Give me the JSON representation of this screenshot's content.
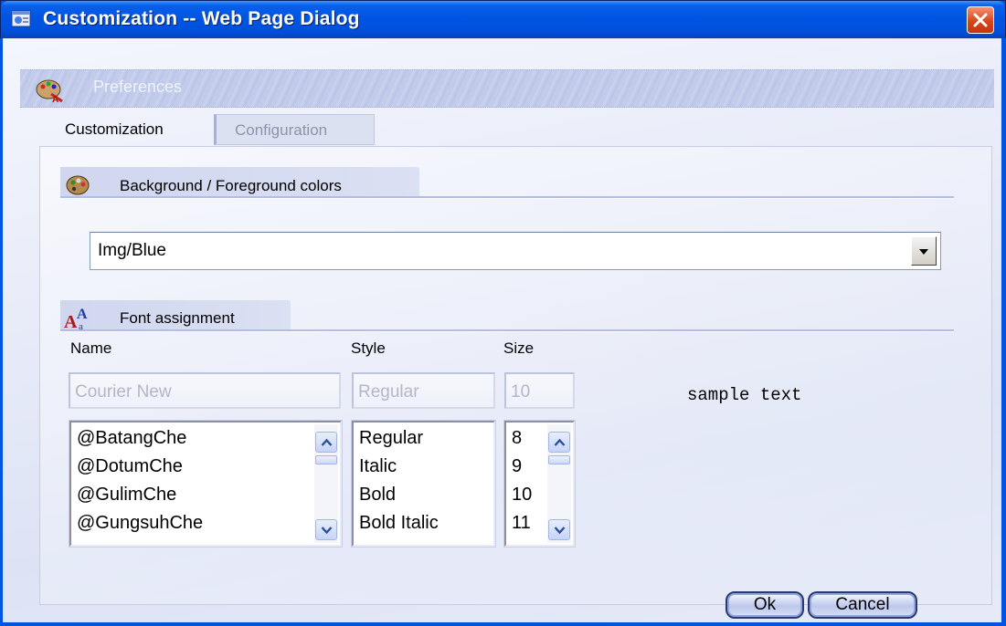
{
  "window": {
    "title": "Customization -- Web Page Dialog"
  },
  "header": {
    "label": "Preferences"
  },
  "tabs": [
    {
      "label": "Customization",
      "active": true
    },
    {
      "label": "Configuration",
      "active": false
    }
  ],
  "colors_section": {
    "title": "Background / Foreground colors",
    "selected": "Img/Blue"
  },
  "font_section": {
    "title": "Font assignment",
    "name_label": "Name",
    "style_label": "Style",
    "size_label": "Size",
    "name_value": "Courier New",
    "style_value": "Regular",
    "size_value": "10",
    "sample": "sample text",
    "name_list": [
      "@BatangChe",
      "@DotumChe",
      "@GulimChe",
      "@GungsuhChe"
    ],
    "style_list": [
      "Regular",
      "Italic",
      "Bold",
      "Bold Italic"
    ],
    "size_list": [
      "8",
      "9",
      "10",
      "11"
    ]
  },
  "buttons": {
    "ok": "Ok",
    "cancel": "Cancel"
  },
  "icons": {
    "title": "ie-dialog-icon",
    "header": "palette-icon",
    "colors": "palette-icon",
    "fonts": "font-icon",
    "close": "close-icon"
  },
  "colors": {
    "title_bar": "#0054e3",
    "close_button": "#d94418",
    "panel_background": "#e7ebf8"
  }
}
